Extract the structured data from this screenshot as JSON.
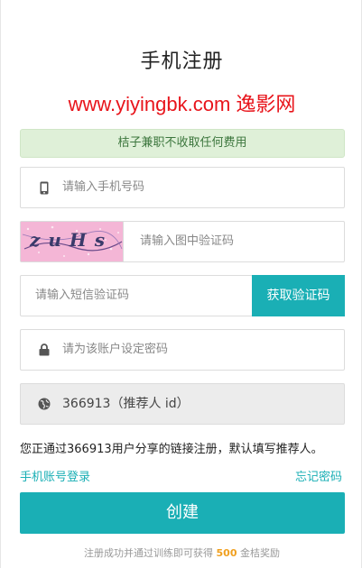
{
  "page": {
    "title": "手机注册",
    "watermark": "www.yiyingbk.com 逸影网",
    "notice": "桔子兼职不收取任何费用"
  },
  "form": {
    "phone_placeholder": "请输入手机号码",
    "captcha_text": "zuHs",
    "captcha_placeholder": "请输入图中验证码",
    "sms_placeholder": "请输入短信验证码",
    "sms_button": "获取验证码",
    "password_placeholder": "请为该账户设定密码",
    "referrer_value": "366913（推荐人 id）"
  },
  "info": {
    "referral_message": "您正通过366913用户分享的链接注册，默认填写推荐人。"
  },
  "links": {
    "phone_login": "手机账号登录",
    "forgot_password": "忘记密码"
  },
  "actions": {
    "create": "创建"
  },
  "footer": {
    "prefix": "注册成功并通过训练即可获得",
    "amount": "500",
    "suffix": "金桔奖励"
  },
  "icons": {
    "phone": "mobile-phone-icon",
    "password": "lock-icon",
    "referrer": "globe-icon"
  },
  "colors": {
    "accent": "#1aafb5",
    "notice_bg": "#dff0d8",
    "notice_text": "#3c763d",
    "watermark": "#e8141b",
    "highlight": "#f0a020"
  }
}
